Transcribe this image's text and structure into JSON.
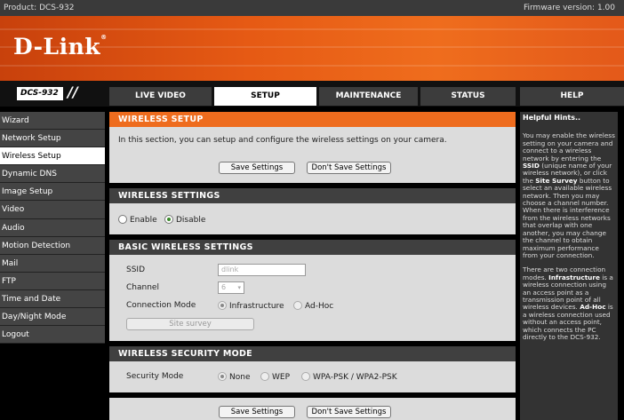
{
  "top": {
    "product": "Product: DCS-932",
    "firmware": "Firmware version: 1.00"
  },
  "brand": {
    "logo": "D-Link",
    "model": "DCS-932",
    "slashes": "//"
  },
  "tabs": [
    "LIVE VIDEO",
    "SETUP",
    "MAINTENANCE",
    "STATUS",
    "HELP"
  ],
  "active_tab": "SETUP",
  "sidebar": {
    "items": [
      "Wizard",
      "Network Setup",
      "Wireless Setup",
      "Dynamic DNS",
      "Image Setup",
      "Video",
      "Audio",
      "Motion Detection",
      "Mail",
      "FTP",
      "Time and Date",
      "Day/Night Mode",
      "Logout"
    ],
    "active": "Wireless Setup"
  },
  "wireless_setup": {
    "title": "WIRELESS SETUP",
    "desc": "In this section, you can setup and configure the wireless settings on your camera.",
    "save": "Save Settings",
    "dont_save": "Don't Save Settings"
  },
  "wireless_settings": {
    "title": "WIRELESS SETTINGS",
    "enable": "Enable",
    "disable": "Disable",
    "selected": "Disable"
  },
  "basic": {
    "title": "BASIC WIRELESS SETTINGS",
    "ssid_label": "SSID",
    "ssid_value": "dlink",
    "channel_label": "Channel",
    "channel_value": "6",
    "mode_label": "Connection Mode",
    "infrastructure": "Infrastructure",
    "adhoc": "Ad-Hoc",
    "mode_selected": "Infrastructure",
    "site_survey": "Site survey"
  },
  "security": {
    "title": "WIRELESS SECURITY MODE",
    "label": "Security Mode",
    "none": "None",
    "wep": "WEP",
    "wpa": "WPA-PSK / WPA2-PSK",
    "selected": "None"
  },
  "bottom": {
    "save": "Save Settings",
    "dont_save": "Don't Save Settings"
  },
  "hints": {
    "title": "Helpful Hints..",
    "p1_a": "You may enable the wireless setting on your camera and connect to a wireless network by entering the ",
    "p1_ssid": "SSID",
    "p1_b": " (unique name of your wireless network), or click the ",
    "p1_site": "Site Survey",
    "p1_c": " button to select an available wireless network. Then you may choose a channel number. When there is interference from the wireless networks that overlap with one another, you may change the channel to obtain maximum performance from your connection.",
    "p2_a": "There are two connection modes. ",
    "p2_infra": "Infrastructure",
    "p2_b": " is a wireless connection using an access point as a transmission point of all wireless devices. ",
    "p2_adhoc": "Ad-Hoc",
    "p2_c": " is a wireless connection used without an access point, which connects the PC directly to the DCS-932."
  },
  "colors": {
    "orange": "#ee6c1e",
    "banner": "#e65a14",
    "dark": "#404040"
  }
}
